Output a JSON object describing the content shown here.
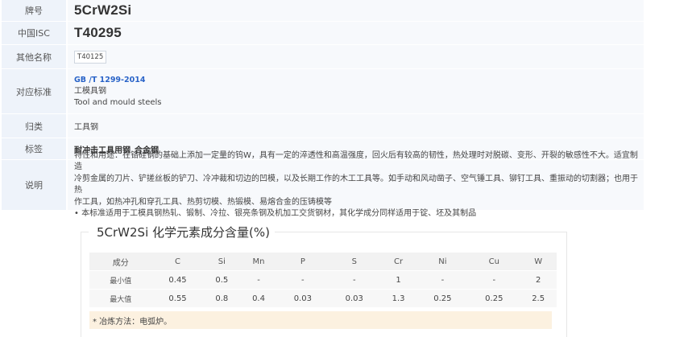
{
  "info": {
    "grade_label": "牌号",
    "grade_value": "5CrW2Si",
    "isc_label": "中国ISC",
    "isc_value": "T40295",
    "other_names_label": "其他名称",
    "other_names": [
      "T40125"
    ],
    "standard_label": "对应标准",
    "standard_link": "GB /T 1299-2014",
    "standard_cn": "工模具钢",
    "standard_en": "Tool and mould steels",
    "category_label": "归类",
    "category_value": "工具钢",
    "tags_label": "标签",
    "tags": [
      "耐冲击工具用钢",
      "合金钢"
    ],
    "desc_label": "说明",
    "desc_lines": [
      "特性和用途：在铬硅钢的基础上添加一定量的钨W，具有一定的淬透性和高温强度，回火后有较高的韧性，热处理时对脱碳、变形、开裂的敏感性不大。适宜制造",
      "冷剪金属的刀片、铲搓丝板的铲刀、冷冲裁和切边的凹模，以及长期工作的木工工具等。如手动和风动凿子、空气锤工具、铆钉工具、重振动的切割器；也用于热",
      "作工具，如热冲孔和穿孔工具、热剪切模、热锻模、易熔合金的压铸模等",
      "• 本标准适用于工模具钢热轧、锻制、冷拉、银亮条钢及机加工交货钢材，其化学成分同样适用于锭、坯及其制品"
    ]
  },
  "chem": {
    "title": "5CrW2Si 化学元素成分含量(%)",
    "headers": [
      "成分",
      "C",
      "Si",
      "Mn",
      "P",
      "S",
      "Cr",
      "Ni",
      "Cu",
      "W"
    ],
    "rows": [
      [
        "最小值",
        "0.45",
        "0.5",
        "-",
        "-",
        "-",
        "1",
        "-",
        "-",
        "2"
      ],
      [
        "最大值",
        "0.55",
        "0.8",
        "0.4",
        "0.03",
        "0.03",
        "1.3",
        "0.25",
        "0.25",
        "2.5"
      ]
    ],
    "note": "* 冶炼方法：电弧炉。"
  }
}
